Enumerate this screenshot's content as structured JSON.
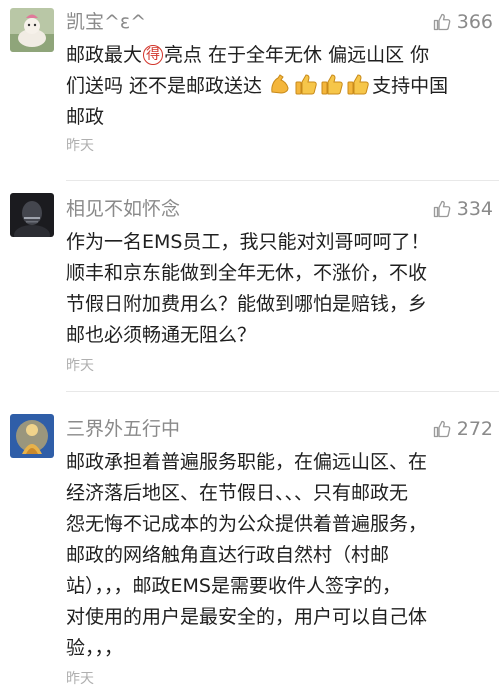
{
  "comments": [
    {
      "username": "凯宝^ε^",
      "likes": "366",
      "line1_pre": "邮政最大",
      "line1_badge": "得",
      "line1_post": "亮点 在于全年无休 偏远山区 你",
      "line2_pre": "们送吗 还不是邮政送达",
      "line2_emojis": [
        "flexed-biceps-emoji",
        "thumbs-up-emoji",
        "thumbs-up-emoji",
        "thumbs-up-emoji"
      ],
      "line2_post": "支持中国",
      "line3": "邮政",
      "time": "昨天"
    },
    {
      "username": "相见不如怀念",
      "likes": "334",
      "lines": [
        "作为一名EMS员工，我只能对刘哥呵呵了！",
        "顺丰和京东能做到全年无休，不涨价，不收",
        "节假日附加费用么？能做到哪怕是赔钱，乡",
        "邮也必须畅通无阻么？"
      ],
      "time": "昨天"
    },
    {
      "username": "三界外五行中",
      "likes": "272",
      "lines": [
        "邮政承担着普遍服务职能，在偏远山区、在",
        "经济落后地区、在节假日、、、只有邮政无",
        "怨无悔不记成本的为公众提供着普遍服务，",
        "邮政的网络触角直达行政自然村（村邮",
        "站），，，邮政EMS是需要收件人签字的，",
        "对使用的用户是最安全的，用户可以自己体",
        "验，，，"
      ],
      "time": "昨天"
    }
  ]
}
